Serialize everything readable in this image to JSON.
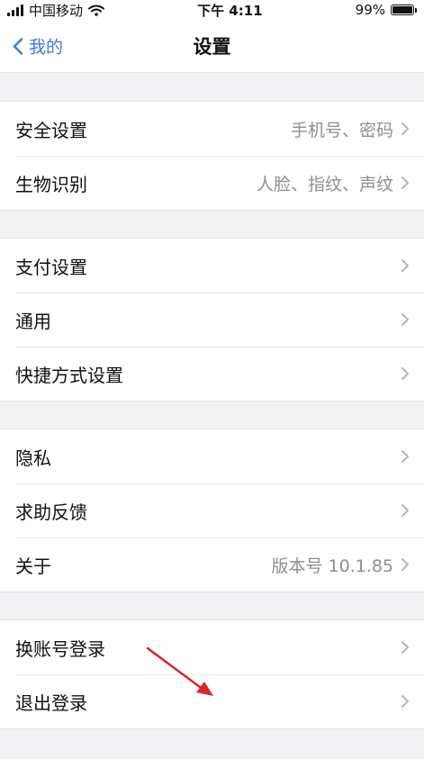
{
  "status_bar": {
    "carrier": "中国移动",
    "time": "下午 4:11",
    "battery_percent": "99%",
    "battery_level": 0.99
  },
  "nav": {
    "back_label": "我的",
    "title": "设置"
  },
  "groups": [
    {
      "items": [
        {
          "label": "安全设置",
          "value": "手机号、密码"
        },
        {
          "label": "生物识别",
          "value": "人脸、指纹、声纹"
        }
      ]
    },
    {
      "items": [
        {
          "label": "支付设置",
          "value": ""
        },
        {
          "label": "通用",
          "value": ""
        },
        {
          "label": "快捷方式设置",
          "value": ""
        }
      ]
    },
    {
      "items": [
        {
          "label": "隐私",
          "value": ""
        },
        {
          "label": "求助反馈",
          "value": ""
        },
        {
          "label": "关于",
          "value": "版本号 10.1.85"
        }
      ]
    },
    {
      "items": [
        {
          "label": "换账号登录",
          "value": ""
        },
        {
          "label": "退出登录",
          "value": ""
        }
      ]
    }
  ],
  "colors": {
    "accent": "#3b7cd8",
    "annotation_arrow": "#d8252a",
    "background": "#f2f2f4"
  },
  "icons": {
    "back": "chevron-left-icon",
    "row_disclosure": "chevron-right-icon",
    "annotation": "red-arrow-icon"
  }
}
